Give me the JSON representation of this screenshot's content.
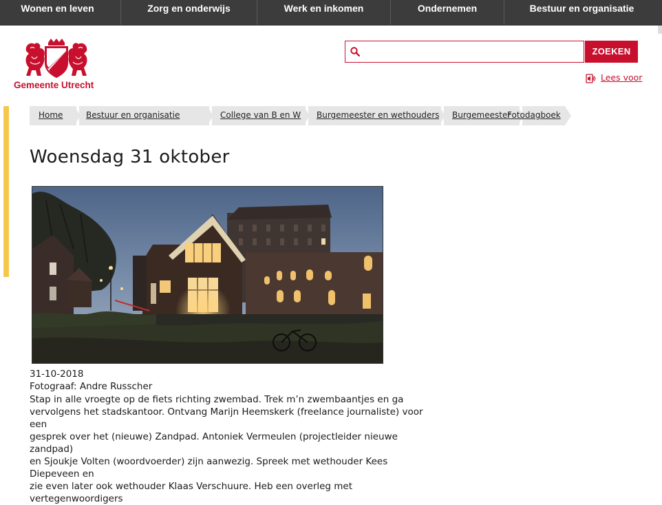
{
  "topnav": {
    "items": [
      {
        "label": "Wonen en leven"
      },
      {
        "label": "Zorg en onderwijs"
      },
      {
        "label": "Werk en inkomen"
      },
      {
        "label": "Ondernemen"
      },
      {
        "label": "Bestuur en organisatie"
      }
    ]
  },
  "logo": {
    "text": "Gemeente Utrecht",
    "brand_color": "#c8102e"
  },
  "search": {
    "value": "",
    "placeholder": "",
    "button_label": "ZOEKEN",
    "icon": "search-icon"
  },
  "read_aloud": {
    "label": "Lees voor",
    "icon": "speaker-icon"
  },
  "breadcrumb": [
    {
      "label": "Home"
    },
    {
      "label": "Bestuur en organisatie"
    },
    {
      "label": "College van B en W"
    },
    {
      "label": "Burgemeester en wethouders"
    },
    {
      "label": "Burgemeester"
    },
    {
      "label": "Fotodagboek"
    }
  ],
  "page": {
    "title": "Woensdag 31 oktober",
    "date": "31-10-2018",
    "photographer": "Fotograaf: Andre Russcher",
    "body_lines": [
      "Stap in alle vroegte op de fiets richting zwembad. Trek m’n zwembaantjes en ga",
      "vervolgens het stadskantoor. Ontvang Marijn Heemskerk (freelance journaliste) voor een",
      "gesprek over het (nieuwe) Zandpad. Antoniek Vermeulen (projectleider nieuwe zandpad)",
      "en Sjoukje Volten (woordvoerder) zijn aanwezig. Spreek met wethouder Kees Diepeveen en",
      "zie even later ook wethouder Klaas Verschuure. Heb een overleg met vertegenwoordigers"
    ]
  },
  "colors": {
    "accent_yellow": "#f5c84c",
    "nav_bg": "#3c3c3c",
    "brand_red": "#c8102e",
    "crumb_bg": "#e6e6e6"
  }
}
